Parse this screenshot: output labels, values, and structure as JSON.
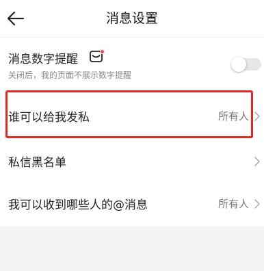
{
  "header": {
    "title": "消息设置",
    "back_icon": "arrow-left-icon"
  },
  "settings": {
    "badge_row": {
      "label": "消息数字提醒",
      "sublabel": "关闭后，我的页面不展示数字提醒",
      "icon": "message-badge-icon",
      "toggle_on": false
    },
    "who_can_message": {
      "label": "谁可以给我发私",
      "value": "所有人"
    },
    "blacklist": {
      "label": "私信黑名单"
    },
    "at_mentions": {
      "label": "我可以收到哪些人的@消息",
      "value": "所有人"
    }
  },
  "colors": {
    "highlight": "#e22826",
    "badge_dot": "#e5484d",
    "toggle_off": "#e6e6e6",
    "background": "#f4f4f4"
  }
}
